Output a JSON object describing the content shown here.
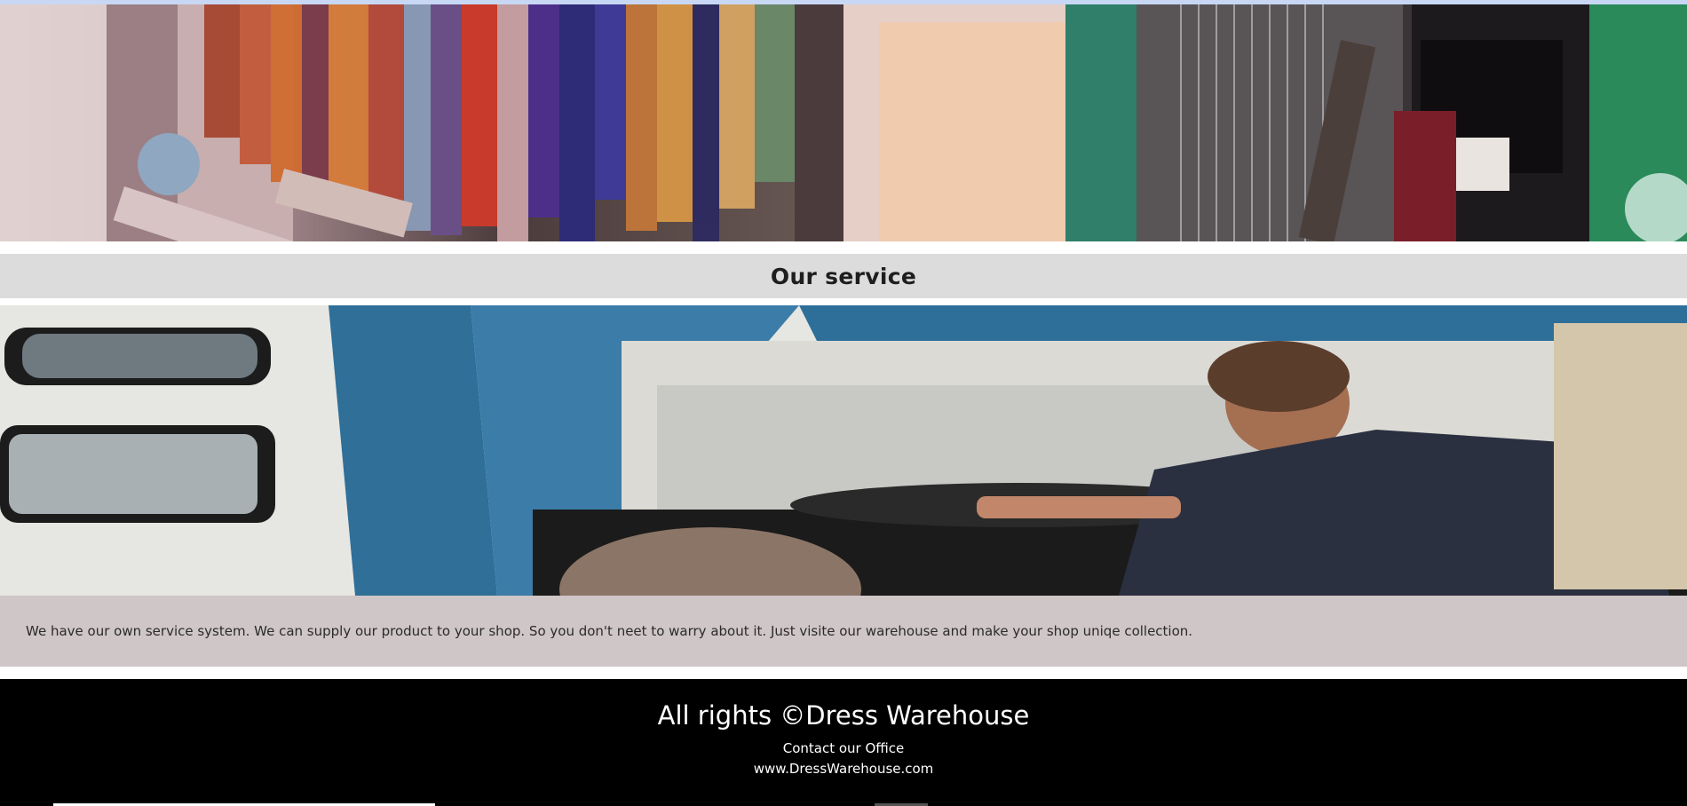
{
  "gallery": {
    "left_image_icon": "yarn-dye-photo",
    "right_image_icon": "loom-weaver-photo"
  },
  "service": {
    "heading": "Our service",
    "image_icon": "delivery-truck-driver-photo",
    "description": "We have our own service system. We can supply our product to your shop. So you don't neet to warry about it. Just visite our warehouse and make your shop uniqe collection."
  },
  "footer": {
    "title": "All rights ©Dress Warehouse",
    "contact": "Contact our Office",
    "website": "www.DressWarehouse.com"
  },
  "colors": {
    "band_gray": "#dcdcdc",
    "description_bg": "#cfc6c7",
    "footer_bg": "#000000",
    "accent_top": "#c8d8f4"
  }
}
